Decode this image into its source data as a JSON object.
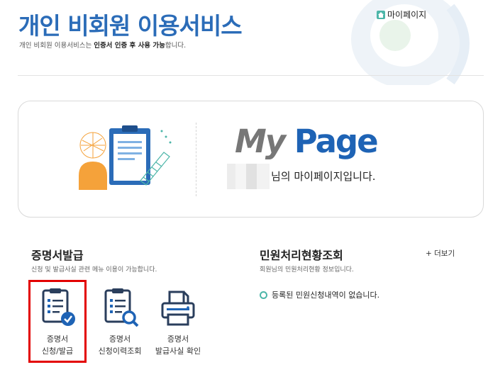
{
  "header": {
    "title": "개인 비회원 이용서비스",
    "subtitle_prefix": "개인 비회원 이용서비스는 ",
    "subtitle_bold": "인증서 인증 후 사용 가능",
    "subtitle_suffix": "합니다.",
    "mypage_link": "마이페이지"
  },
  "banner": {
    "logo_my": "My",
    "logo_page": "Page",
    "greeting": "님의 마이페이지입니다."
  },
  "certificate_section": {
    "title": "증명서발급",
    "description": "신청 및 발급사실 관련 메뉴 이용이 가능합니다.",
    "items": [
      {
        "label": "증명서\n신청/발급",
        "icon": "clipboard-check-icon"
      },
      {
        "label": "증명서\n신청이력조회",
        "icon": "clipboard-search-icon"
      },
      {
        "label": "증명서\n발급사실 확인",
        "icon": "printer-icon"
      }
    ]
  },
  "petition_section": {
    "title": "민원처리현황조회",
    "description": "회원님의 민원처리현황 정보입니다.",
    "more_link": "+ 더보기",
    "notice": "등록된 민원신청내역이 없습니다."
  },
  "colors": {
    "title_blue": "#2b6cb8",
    "logo_blue": "#1e63b5",
    "teal": "#4db6a9",
    "orange": "#f5a23a",
    "highlight_red": "#e30000",
    "icon_navy": "#2a3e5c"
  }
}
